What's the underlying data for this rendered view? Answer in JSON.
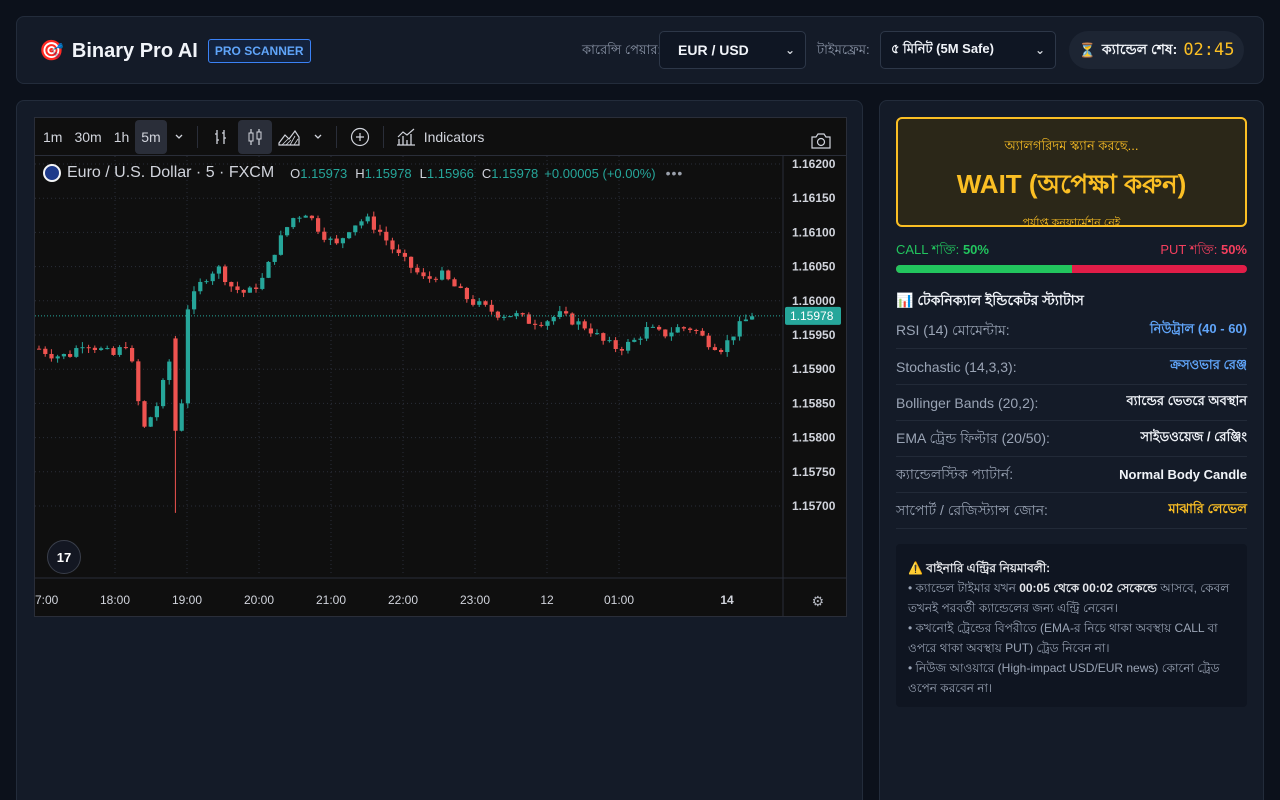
{
  "app": {
    "icon": "🎯",
    "icon_name": "target-icon",
    "name": "Binary Pro AI",
    "badge": "PRO SCANNER"
  },
  "controls": {
    "pair_label": "কারেন্সি পেয়ার:",
    "pair_value": "EUR / USD",
    "timeframe_label": "টাইমফ্রেম:",
    "timeframe_value": "৫ মিনিট (5M Safe)",
    "timer_icon": "⏳",
    "timer_label": "ক্যান্ডেল শেষ:",
    "timer_value": "02:45"
  },
  "chart_toolbar": {
    "intervals": [
      "1m",
      "30m",
      "1h",
      "5m"
    ],
    "active_interval": "5m",
    "indicators_label": "Indicators"
  },
  "chart_legend": {
    "symbol": "Euro / U.S. Dollar · 5 · FXCM",
    "o_label": "O",
    "o": "1.15973",
    "h_label": "H",
    "h": "1.15978",
    "l_label": "L",
    "l": "1.15966",
    "c_label": "C",
    "c": "1.15978",
    "change": "+0.00005 (+0.00%)"
  },
  "chart_data": {
    "type": "candlestick",
    "title": "",
    "xlabel": "",
    "ylabel": "",
    "ylim": [
      1.1566,
      1.1622
    ],
    "y_ticks": [
      "1.16200",
      "1.16150",
      "1.16100",
      "1.16050",
      "1.16000",
      "1.15950",
      "1.15900",
      "1.15850",
      "1.15800",
      "1.15750",
      "1.15700"
    ],
    "x_ticks": [
      "7:00",
      "18:00",
      "19:00",
      "20:00",
      "21:00",
      "22:00",
      "23:00",
      "12",
      "01:00",
      "14"
    ],
    "last_price": "1.15978",
    "up_color": "#26a69a",
    "down_color": "#ef5350",
    "close_path": [
      1.1593,
      1.1592,
      1.1592,
      1.1594,
      1.1593,
      1.1592,
      1.1594,
      1.1581,
      1.1585,
      1.1593,
      1.1599,
      1.1603,
      1.1605,
      1.1602,
      1.1601,
      1.1603,
      1.1608,
      1.1612,
      1.1613,
      1.161,
      1.1608,
      1.1611,
      1.1612,
      1.161,
      1.1607,
      1.1605,
      1.1603,
      1.1604,
      1.1602,
      1.16,
      1.1599,
      1.1598,
      1.1598,
      1.1597,
      1.1597,
      1.1598,
      1.1597,
      1.1596,
      1.1594,
      1.1593,
      1.1594,
      1.1596,
      1.1595,
      1.1596,
      1.1596,
      1.1594,
      1.1593,
      1.1596,
      1.1598
    ]
  },
  "signal": {
    "status": "অ্যালগরিদম স্ক্যান করছে...",
    "main": "WAIT (অপেক্ষা করুন)",
    "sub": "পর্যাপ্ত কনফার্মেশন নেই"
  },
  "strength": {
    "call_label": "CALL শক্তি:",
    "call_value": "50%",
    "call_fraction": 0.5,
    "put_label": "PUT শক্তি:",
    "put_value": "50%"
  },
  "indicators": {
    "icon_name": "bar-chart-icon",
    "title": "📊 টেকনিক্যাল ইন্ডিকেটর স্ট্যাটাস",
    "rows": [
      {
        "name": "RSI (14) মোমেন্টাম:",
        "value": "নিউট্রাল (40 - 60)",
        "color": "#60a5fa"
      },
      {
        "name": "Stochastic (14,3,3):",
        "value": "ক্রসওভার রেঞ্জ",
        "color": "#60a5fa"
      },
      {
        "name": "Bollinger Bands (20,2):",
        "value": "ব্যান্ডের ভেতরে অবস্থান",
        "color": "#f1f4f9"
      },
      {
        "name": "EMA ট্রেন্ড ফিল্টার (20/50):",
        "value": "সাইডওয়েজ / রেঞ্জিং",
        "color": "#f1f4f9"
      },
      {
        "name": "ক্যান্ডেলস্টিক প্যাটার্ন:",
        "value": "Normal Body Candle",
        "color": "#f1f4f9"
      },
      {
        "name": "সাপোর্ট / রেজিস্ট্যান্স জোন:",
        "value": "মাঝারি লেভেল",
        "color": "#fbbf24"
      }
    ]
  },
  "rules": {
    "title": "⚠️ বাইনারি এন্ট্রির নিয়মাবলী:",
    "line1_pre": "• ক্যান্ডেল টাইমার যখন ",
    "line1_bold": "00:05 থেকে 00:02 সেকেন্ডে",
    "line1_post": " আসবে, কেবল তখনই পরবর্তী ক্যান্ডেলের জন্য এন্ট্রি নেবেন।",
    "line2": "• কখনোই ট্রেন্ডের বিপরীতে (EMA-র নিচে থাকা অবস্থায় CALL বা ওপরে থাকা অবস্থায় PUT) ট্রেড নিবেন না।",
    "line3": "• নিউজ আওয়ারে (High-impact USD/EUR news) কোনো ট্রেড ওপেন করবেন না।"
  }
}
